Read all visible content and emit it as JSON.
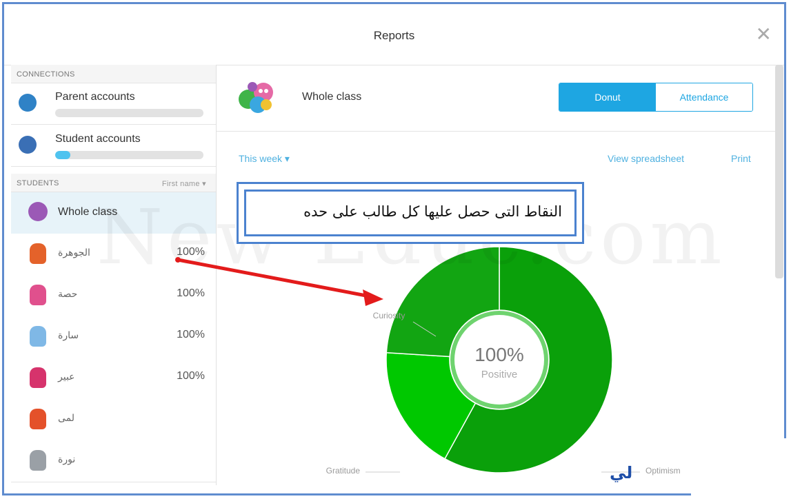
{
  "window": {
    "title": "Reports"
  },
  "sidebar": {
    "connections_header": "CONNECTIONS",
    "connections": [
      {
        "label": "Parent accounts",
        "progress": 0.0,
        "icon": "blue-monster-icon",
        "color": "#2f82c6"
      },
      {
        "label": "Student accounts",
        "progress": 0.1,
        "icon": "blue-monster-icon",
        "color": "#3a6fb5"
      }
    ],
    "students_header": "STUDENTS",
    "sort_label": "First name ▾",
    "students": [
      {
        "name": "Whole class",
        "percent": "",
        "selected": true,
        "color": "#9b59b6"
      },
      {
        "name": "الجوهرة",
        "percent": "100%",
        "color": "#e4622a"
      },
      {
        "name": "حصة",
        "percent": "100%",
        "color": "#e0508d"
      },
      {
        "name": "سارة",
        "percent": "100%",
        "color": "#7fb8e6"
      },
      {
        "name": "عبير",
        "percent": "100%",
        "color": "#d6336c"
      },
      {
        "name": "لمى",
        "percent": "",
        "color": "#e4512a"
      },
      {
        "name": "نورة",
        "percent": "",
        "color": "#9aa0a6"
      }
    ]
  },
  "main": {
    "class_name": "Whole class",
    "view_toggle": {
      "active": "Donut",
      "inactive": "Attendance"
    },
    "period": "This week ▾",
    "view_spreadsheet": "View spreadsheet",
    "print": "Print"
  },
  "annotation": {
    "text": "النقاط التى حصل عليها كل طالب على حده"
  },
  "watermark": "New Educ.com",
  "corner_text": "لي",
  "chart_data": {
    "type": "pie",
    "center_value": "100%",
    "center_label": "Positive",
    "categories": [
      "Optimism",
      "Gratitude",
      "Curiosity"
    ],
    "values": [
      58,
      18,
      24
    ],
    "colors": [
      "#0aa00a",
      "#00c800",
      "#12a512"
    ]
  }
}
